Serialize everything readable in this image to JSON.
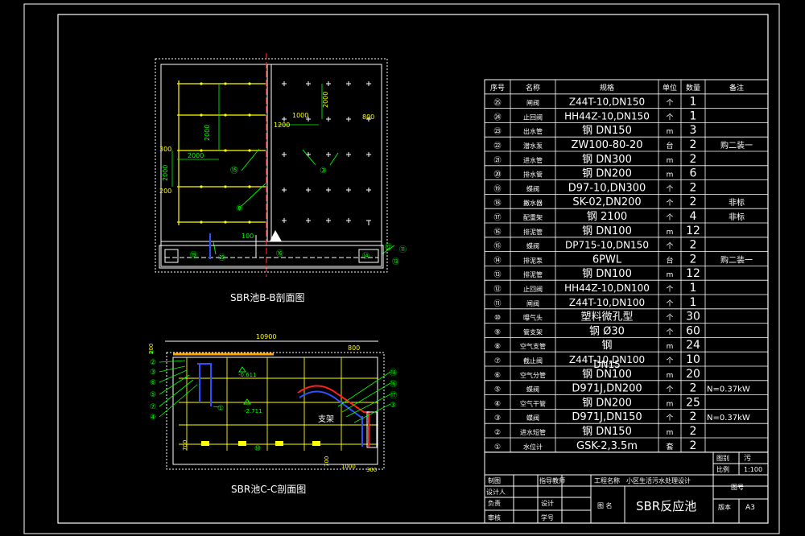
{
  "drawing": {
    "bb_title": "SBR池B-B剖面图",
    "cc_title": "SBR池C-C剖面图",
    "bb_dims": [
      "2000",
      "2000",
      "2000",
      "300",
      "200",
      "1200",
      "1000",
      "800",
      "2000",
      "100"
    ],
    "cc_dims": [
      "10900",
      "800",
      "-0.611",
      "-2.711",
      "700",
      "1000",
      "300",
      "200",
      "700"
    ],
    "support_label": "支架",
    "bb_callouts": [
      "⑮",
      "⑧",
      "③",
      "⑲",
      "⑳",
      "⑯",
      "⑭",
      "⑫",
      "⑪",
      "⑬"
    ],
    "cc_callouts": [
      "①",
      "⑩",
      "⑱",
      "⑯",
      "⑰",
      "⑤",
      "⑥",
      "⑦",
      "②",
      "④",
      "③"
    ]
  },
  "table": {
    "headers": [
      "序号",
      "名称",
      "规格",
      "单位",
      "数量",
      "备注"
    ],
    "rows": [
      [
        "㉕",
        "闸阀",
        "Z44T-10,DN150",
        "个",
        "1",
        ""
      ],
      [
        "㉔",
        "止回阀",
        "HH44Z-10,DN150",
        "个",
        "1",
        ""
      ],
      [
        "㉓",
        "出水管",
        "钢 DN150",
        "m",
        "3",
        ""
      ],
      [
        "㉒",
        "潜水泵",
        "ZW100-80-20",
        "台",
        "2",
        "购二装一"
      ],
      [
        "㉑",
        "进水管",
        "钢 DN300",
        "m",
        "2",
        ""
      ],
      [
        "⑳",
        "排水管",
        "钢 DN200",
        "m",
        "6",
        ""
      ],
      [
        "⑲",
        "蝶阀",
        "D97-10,DN300",
        "个",
        "2",
        ""
      ],
      [
        "⑱",
        "撇水器",
        "SK-02,DN200",
        "个",
        "2",
        "非标"
      ],
      [
        "⑰",
        "配重架",
        "钢 2100",
        "个",
        "4",
        "非标"
      ],
      [
        "⑯",
        "排泥管",
        "钢 DN100",
        "m",
        "12",
        ""
      ],
      [
        "⑮",
        "蝶阀",
        "DP715-10,DN150",
        "个",
        "2",
        ""
      ],
      [
        "⑭",
        "排泥泵",
        "6PWL",
        "台",
        "2",
        "购二装一"
      ],
      [
        "⑬",
        "排泥管",
        "钢 DN100",
        "m",
        "12",
        ""
      ],
      [
        "⑫",
        "止回阀",
        "HH44Z-10,DN100",
        "个",
        "1",
        ""
      ],
      [
        "⑪",
        "闸阀",
        "Z44T-10,DN100",
        "个",
        "1",
        ""
      ],
      [
        "⑩",
        "曝气头",
        "塑料微孔型",
        "个",
        "30",
        ""
      ],
      [
        "⑨",
        "管支架",
        "钢 Ø30",
        "个",
        "60",
        ""
      ],
      [
        "⑧",
        "空气支管",
        "钢",
        "m",
        "24",
        ""
      ],
      [
        "⑦",
        "截止阀",
        "Z44T-10,DN100",
        "个",
        "10",
        ""
      ],
      [
        "⑥",
        "空气分管",
        "钢 DN100",
        "m",
        "20",
        ""
      ],
      [
        "⑤",
        "蝶阀",
        "D971J,DN200",
        "个",
        "2",
        "N=0.37kW"
      ],
      [
        "④",
        "空气干管",
        "钢 DN200",
        "m",
        "25",
        ""
      ],
      [
        "③",
        "蝶阀",
        "D971J,DN150",
        "个",
        "2",
        "N=0.37kW"
      ],
      [
        "②",
        "进水短管",
        "钢 DN150",
        "m",
        "2",
        ""
      ],
      [
        "①",
        "水位计",
        "GSK-2,3.5m",
        "套",
        "2",
        ""
      ]
    ],
    "overlap_text": "DN15"
  },
  "titleblock": {
    "sheet_label": "图别",
    "sheet_value": "污",
    "scale_label": "比例",
    "scale_value": "1:100",
    "drawn_label": "制图",
    "design_label": "设计人",
    "lead_label": "负责",
    "review_label": "审核",
    "instructor_label": "指导教师",
    "design_label2": "设计",
    "student_label": "学号",
    "project_label": "工程名称",
    "project_value": "小区生活污水处理设计",
    "fig_no_label": "图号",
    "fig_name_label": "图 名",
    "fig_name": "SBR反应池",
    "version_label": "版本",
    "version_value": "A3"
  }
}
